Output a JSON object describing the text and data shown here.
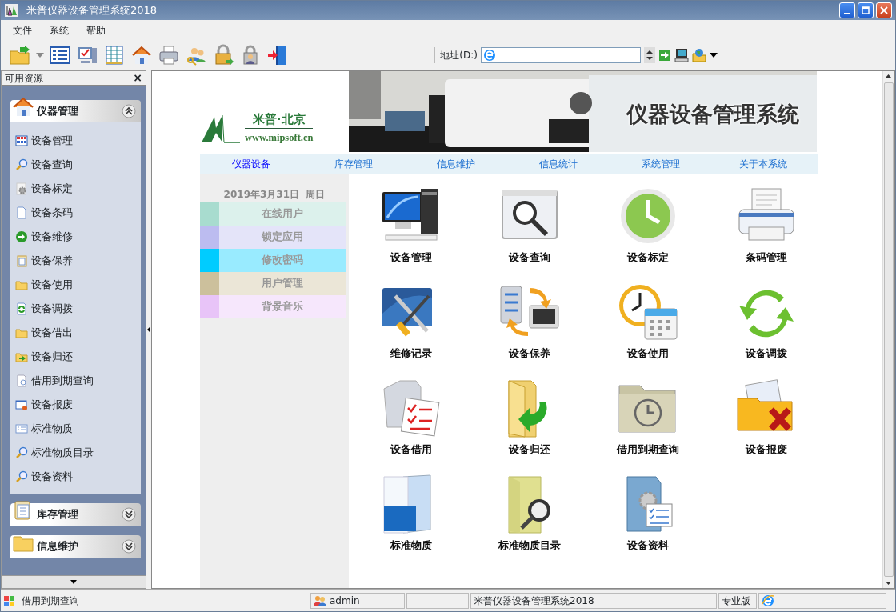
{
  "window": {
    "title": "米普仪器设备管理系统2018"
  },
  "menu": [
    "文件",
    "系统",
    "帮助"
  ],
  "address": {
    "label": "地址(D:)"
  },
  "sidebar": {
    "title": "可用资源",
    "close": "×",
    "sections": [
      {
        "label": "仪器管理",
        "expanded": true,
        "items": [
          "设备管理",
          "设备查询",
          "设备标定",
          "设备条码",
          "设备维修",
          "设备保养",
          "设备使用",
          "设备调拨",
          "设备借出",
          "设备归还",
          "借用到期查询",
          "设备报废",
          "标准物质",
          "标准物质目录",
          "设备资料"
        ]
      },
      {
        "label": "库存管理",
        "expanded": false
      },
      {
        "label": "信息维护",
        "expanded": false
      }
    ]
  },
  "banner": {
    "brand": "米普·北京",
    "url": "www.mipsoft.cn",
    "title": "仪器设备管理系统"
  },
  "nav": [
    {
      "label": "仪器设备",
      "selected": true
    },
    {
      "label": "库存管理",
      "selected": false
    },
    {
      "label": "信息维护",
      "selected": false
    },
    {
      "label": "信息统计",
      "selected": false
    },
    {
      "label": "系统管理",
      "selected": false
    },
    {
      "label": "关于本系统",
      "selected": false
    }
  ],
  "date": "2019年3月31日  周日",
  "quick_links": [
    {
      "label": "在线用户",
      "color": "#a8dccf"
    },
    {
      "label": "锁定应用",
      "color": "#bcbcf0"
    },
    {
      "label": "修改密码",
      "color": "#00ccff"
    },
    {
      "label": "用户管理",
      "color": "#ccc09c"
    },
    {
      "label": "背景音乐",
      "color": "#e8c4f8"
    }
  ],
  "tiles": [
    "设备管理",
    "设备查询",
    "设备标定",
    "条码管理",
    "维修记录",
    "设备保养",
    "设备使用",
    "设备调拨",
    "设备借用",
    "设备归还",
    "借用到期查询",
    "设备报废",
    "标准物质",
    "标准物质目录",
    "设备资料"
  ],
  "status_bar": {
    "task": "借用到期查询",
    "user": "admin",
    "product": "米普仪器设备管理系统2018",
    "edition": "专业版"
  }
}
